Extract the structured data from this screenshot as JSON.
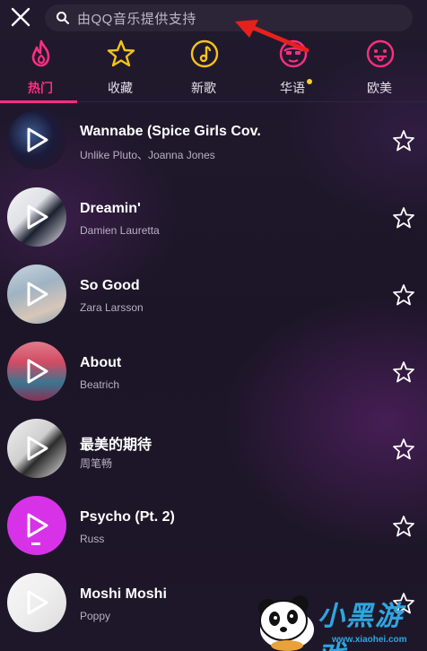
{
  "search": {
    "placeholder": "由QQ音乐提供支持"
  },
  "tabs": [
    {
      "label": "热门",
      "icon": "flame-icon",
      "active": true
    },
    {
      "label": "收藏",
      "icon": "star-icon",
      "active": false
    },
    {
      "label": "新歌",
      "icon": "music-note-icon",
      "active": false
    },
    {
      "label": "华语",
      "icon": "face-icon",
      "active": false,
      "badge_dot": true
    },
    {
      "label": "欧美",
      "icon": "face-tongue-icon",
      "active": false
    }
  ],
  "songs": [
    {
      "title": "Wannabe (Spice Girls Cov.",
      "artist": "Unlike Pluto、Joanna Jones"
    },
    {
      "title": "Dreamin'",
      "artist": "Damien Lauretta"
    },
    {
      "title": "So Good",
      "artist": "Zara Larsson"
    },
    {
      "title": "About",
      "artist": "Beatrich"
    },
    {
      "title": "最美的期待",
      "artist": "周笔畅"
    },
    {
      "title": "Psycho (Pt. 2)",
      "artist": "Russ"
    },
    {
      "title": "Moshi Moshi",
      "artist": "Poppy"
    }
  ],
  "watermark": {
    "brand": "小黑游戏",
    "url": "www.xiaohei.com"
  },
  "colors": {
    "accent": "#ff2e80",
    "tab_icon": "#f5c319",
    "background": "#1d1629",
    "badge_dot": "#f7d21f"
  }
}
